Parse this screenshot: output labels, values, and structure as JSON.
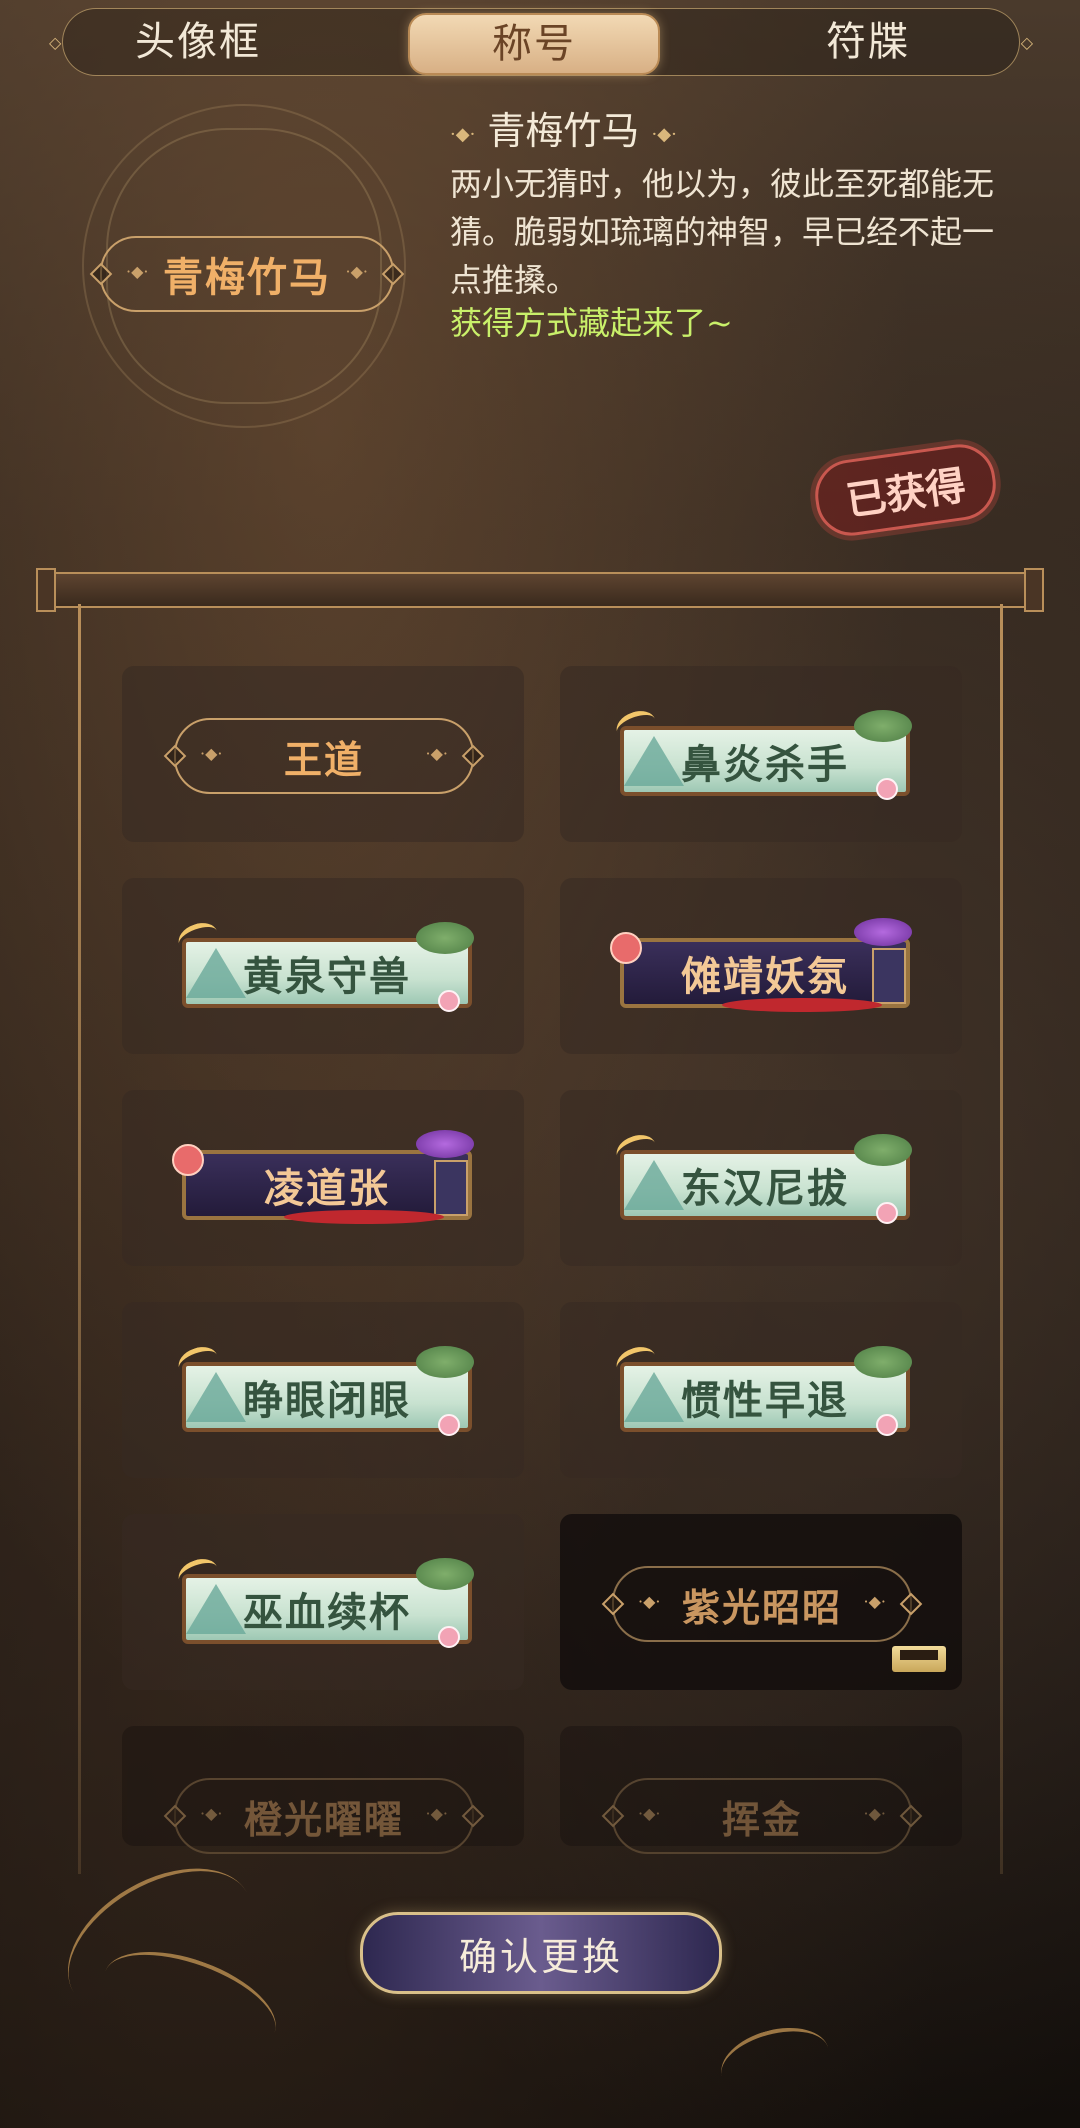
{
  "tabs": [
    {
      "label": "头像框",
      "active": false
    },
    {
      "label": "称号",
      "active": true
    },
    {
      "label": "符牒",
      "active": false
    }
  ],
  "preview": {
    "title": "青梅竹马"
  },
  "info": {
    "name": "青梅竹马",
    "description": "两小无猜时，他以为，彼此至死都能无猜。脆弱如琉璃的神智，早已经不起一点推搡。",
    "acquisition": "获得方式藏起来了~",
    "status_stamp": "已获得"
  },
  "titles": [
    {
      "label": "王道",
      "style": "plain",
      "state": "owned"
    },
    {
      "label": "鼻炎杀手",
      "style": "landscape",
      "state": "owned"
    },
    {
      "label": "黄泉守兽",
      "style": "landscape",
      "state": "owned"
    },
    {
      "label": "傩靖妖氛",
      "style": "purple",
      "state": "owned"
    },
    {
      "label": "凌道张",
      "style": "purple",
      "state": "owned"
    },
    {
      "label": "东汉尼拔",
      "style": "landscape",
      "state": "owned"
    },
    {
      "label": "睁眼闭眼",
      "style": "landscape",
      "state": "owned"
    },
    {
      "label": "惯性早退",
      "style": "landscape",
      "state": "owned"
    },
    {
      "label": "巫血续杯",
      "style": "landscape",
      "state": "owned"
    },
    {
      "label": "紫光昭昭",
      "style": "plain",
      "state": "locked"
    },
    {
      "label": "橙光曜曜",
      "style": "plain",
      "state": "locked"
    },
    {
      "label": "挥金",
      "style": "plain",
      "state": "locked"
    }
  ],
  "confirm_button": "确认更换",
  "colors": {
    "accent_gold": "#c9a06a",
    "active_tab": "#d8b085",
    "acquisition_text": "#c9f06a",
    "stamp_red": "#c9584f"
  }
}
